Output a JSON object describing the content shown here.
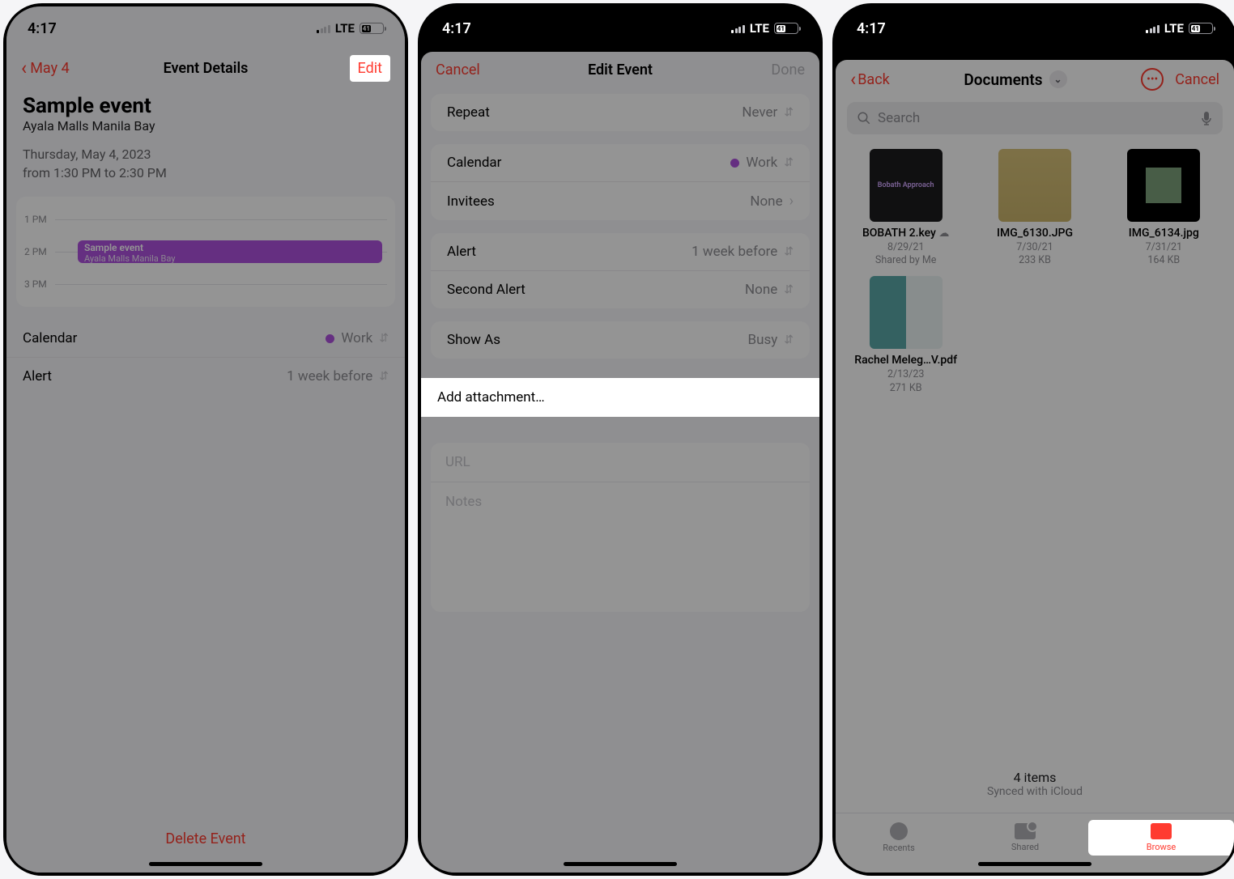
{
  "status": {
    "time": "4:17",
    "network": "LTE",
    "battery": "41"
  },
  "screen1": {
    "back": "May 4",
    "title": "Event Details",
    "edit": "Edit",
    "eventTitle": "Sample event",
    "eventLocation": "Ayala Malls Manila Bay",
    "dateLine": "Thursday, May 4, 2023",
    "timeLine": "from 1:30 PM to 2:30 PM",
    "hours": [
      "1 PM",
      "2 PM",
      "3 PM"
    ],
    "block": {
      "title": "Sample event",
      "sub": "Ayala Malls Manila Bay"
    },
    "rows": {
      "calendarLabel": "Calendar",
      "calendarValue": "Work",
      "alertLabel": "Alert",
      "alertValue": "1 week before"
    },
    "delete": "Delete Event"
  },
  "screen2": {
    "cancel": "Cancel",
    "title": "Edit Event",
    "done": "Done",
    "repeat": {
      "label": "Repeat",
      "value": "Never"
    },
    "calendar": {
      "label": "Calendar",
      "value": "Work"
    },
    "invitees": {
      "label": "Invitees",
      "value": "None"
    },
    "alert": {
      "label": "Alert",
      "value": "1 week before"
    },
    "secondAlert": {
      "label": "Second Alert",
      "value": "None"
    },
    "showAs": {
      "label": "Show As",
      "value": "Busy"
    },
    "addAttachment": "Add attachment…",
    "urlPlaceholder": "URL",
    "notesPlaceholder": "Notes"
  },
  "screen3": {
    "back": "Back",
    "title": "Documents",
    "cancel": "Cancel",
    "searchPlaceholder": "Search",
    "files": [
      {
        "name": "BOBATH 2.key",
        "line1": "8/29/21",
        "line2": "Shared by Me",
        "thumb": "dark"
      },
      {
        "name": "IMG_6130.JPG",
        "line1": "7/30/21",
        "line2": "233 KB",
        "thumb": "scan"
      },
      {
        "name": "IMG_6134.jpg",
        "line1": "7/31/21",
        "line2": "164 KB",
        "thumb": "photo"
      },
      {
        "name": "Rachel Meleg…V.pdf",
        "line1": "2/13/23",
        "line2": "271 KB",
        "thumb": "pdf"
      }
    ],
    "footer1": "4 items",
    "footer2": "Synced with iCloud",
    "tabs": {
      "recents": "Recents",
      "shared": "Shared",
      "browse": "Browse"
    }
  }
}
